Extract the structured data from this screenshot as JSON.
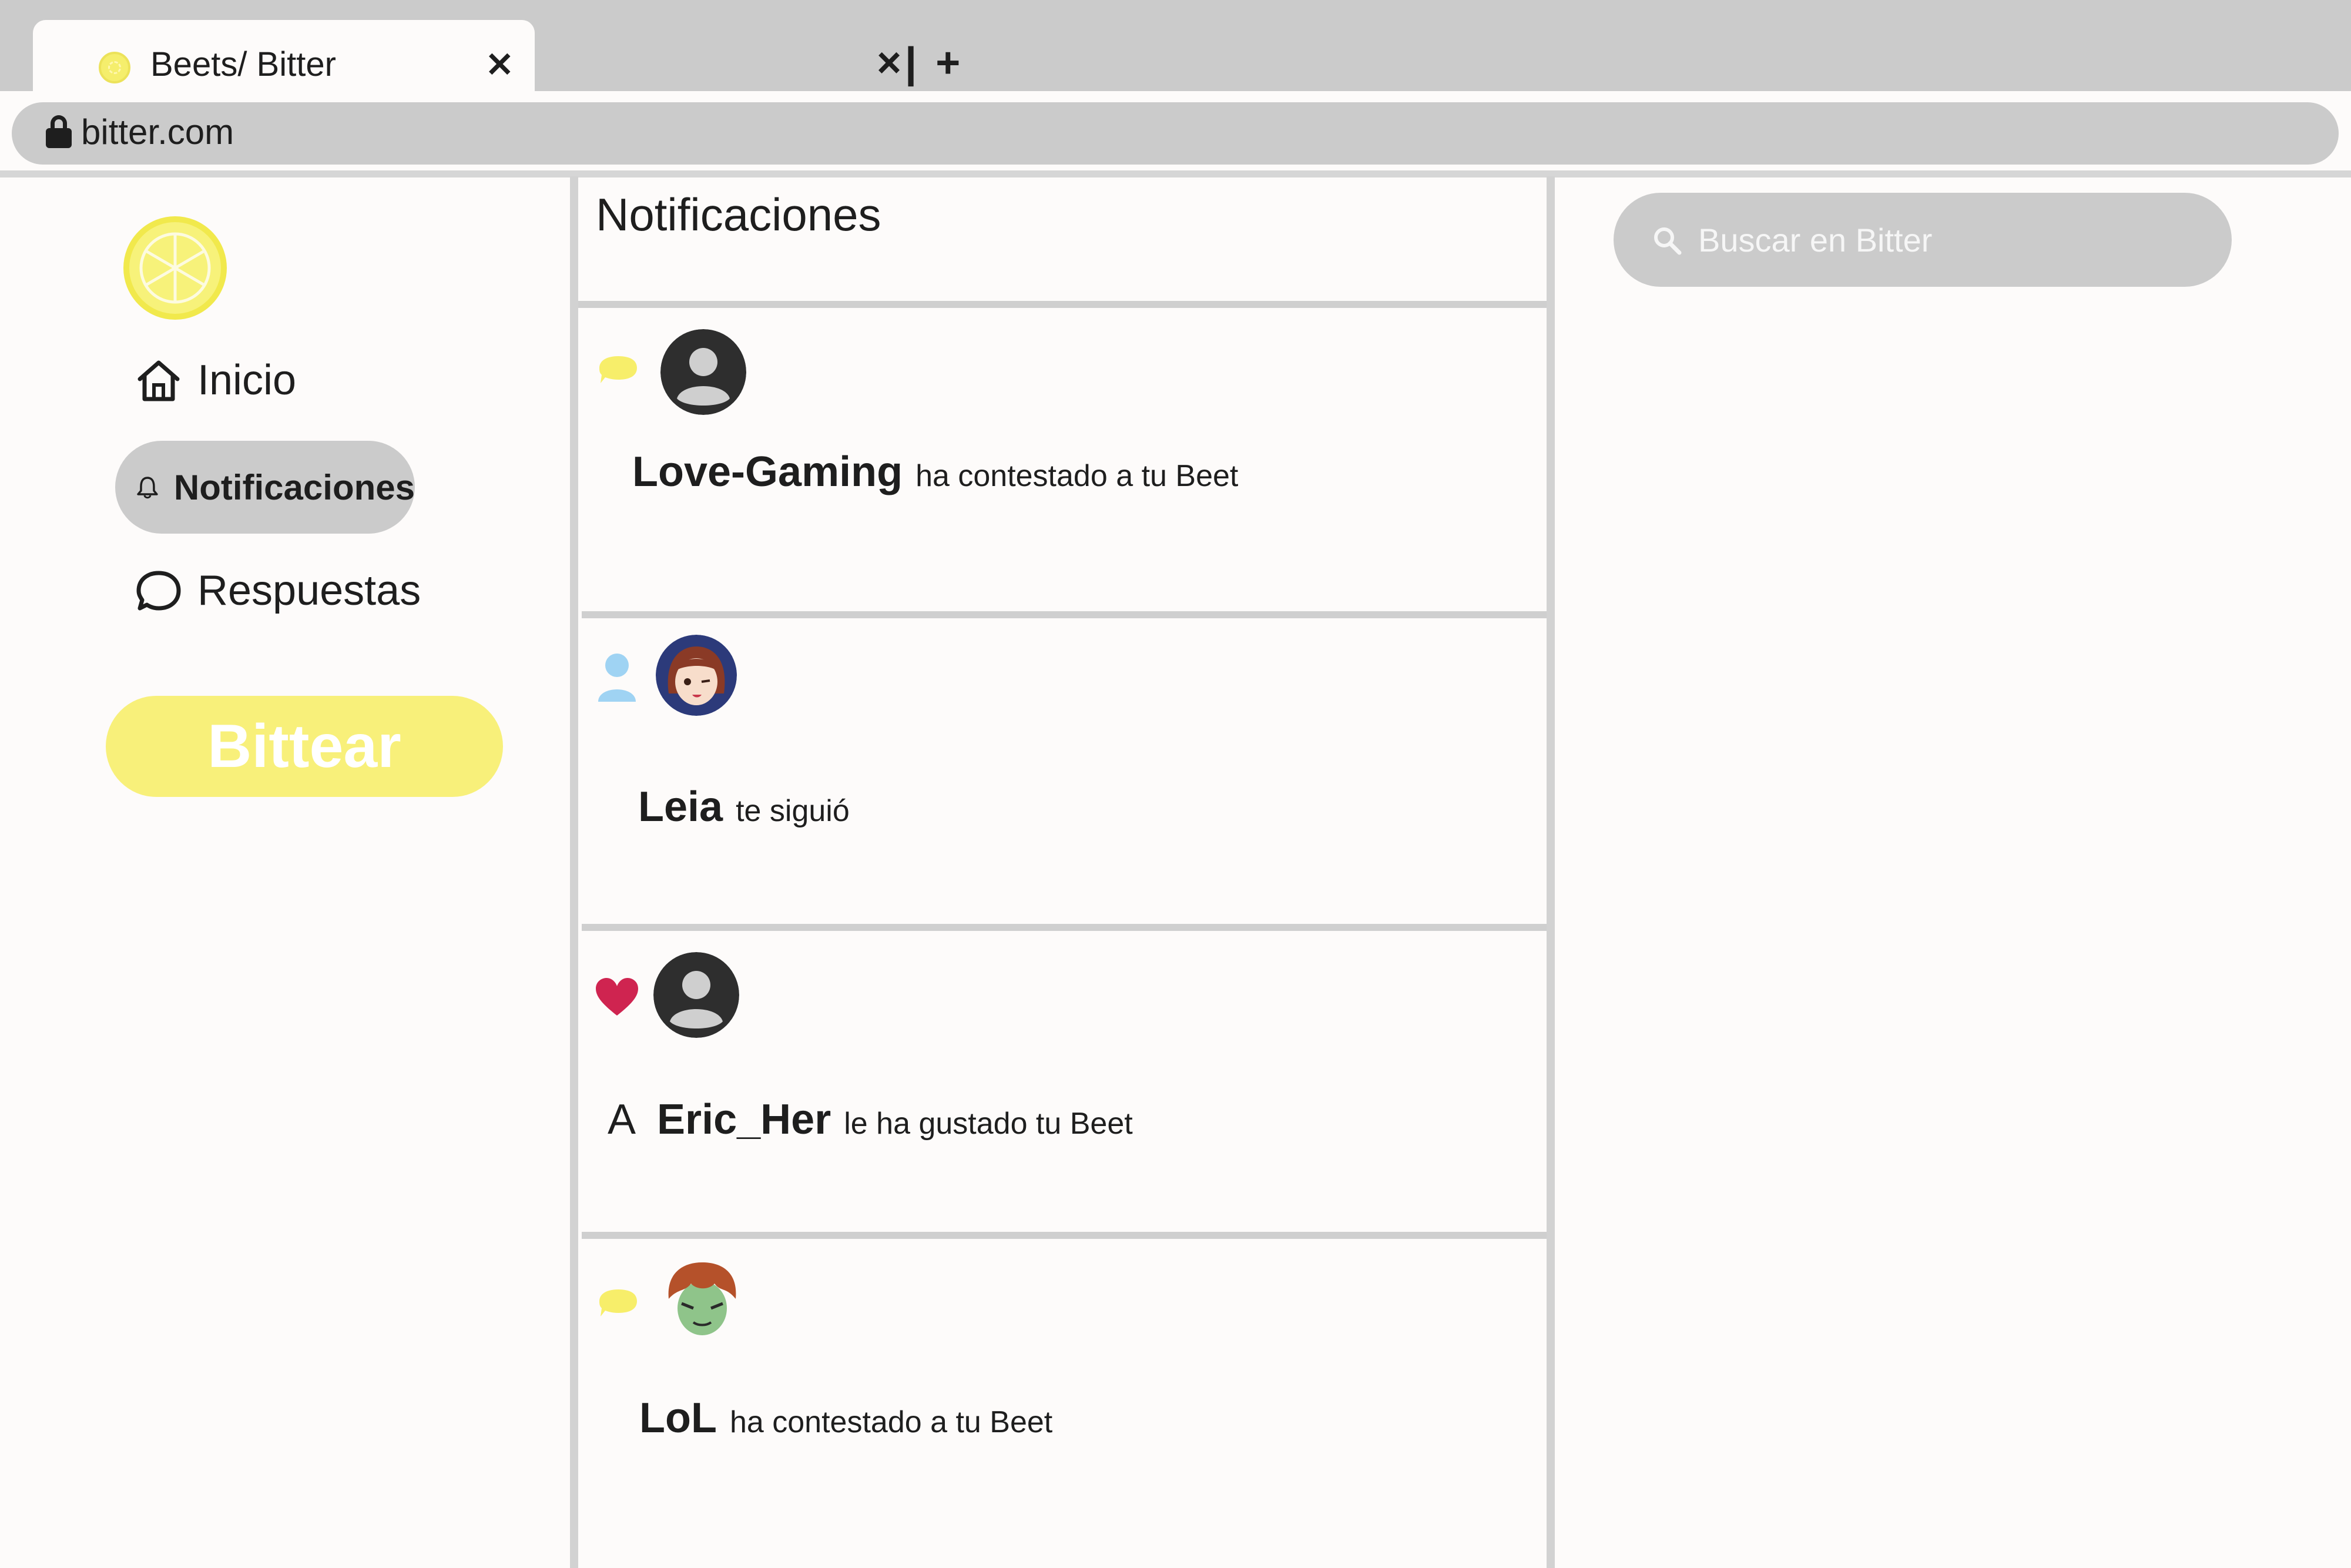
{
  "browser": {
    "tab_title": "Beets/ Bitter",
    "tab_close": "✕",
    "tab_controls": "×| +",
    "url": "bitter.com"
  },
  "sidebar": {
    "items": [
      {
        "label": "Inicio",
        "icon": "home-icon"
      },
      {
        "label": "Notificaciones",
        "icon": "bell-icon",
        "active": true
      },
      {
        "label": "Respuestas",
        "icon": "speech-bubble-icon"
      }
    ],
    "bittear_label": "Bittear"
  },
  "main": {
    "title": "Notificaciones",
    "notifications": [
      {
        "type": "reply",
        "icon": "yellow-speech-bubble-icon",
        "avatar": "default-avatar",
        "prefix": "",
        "user": "Love-Gaming",
        "text": "ha contestado a tu Beet"
      },
      {
        "type": "follow",
        "icon": "blue-person-icon",
        "avatar": "leia-avatar",
        "prefix": "",
        "user": "Leia",
        "text": "te siguió"
      },
      {
        "type": "like",
        "icon": "red-heart-icon",
        "avatar": "default-avatar",
        "prefix": "A",
        "user": "Eric_Her",
        "text": "le ha gustado tu Beet"
      },
      {
        "type": "reply",
        "icon": "yellow-speech-bubble-icon",
        "avatar": "lol-avatar",
        "prefix": "",
        "user": "LoL",
        "text": "ha contestado a tu Beet"
      }
    ]
  },
  "search": {
    "placeholder": "Buscar en Bitter"
  },
  "colors": {
    "chrome_gray": "#cbcbcb",
    "brand_yellow": "#f8f07a",
    "like_red": "#cf2450",
    "follow_blue": "#9fd3f3",
    "background": "#fdfbfa"
  }
}
